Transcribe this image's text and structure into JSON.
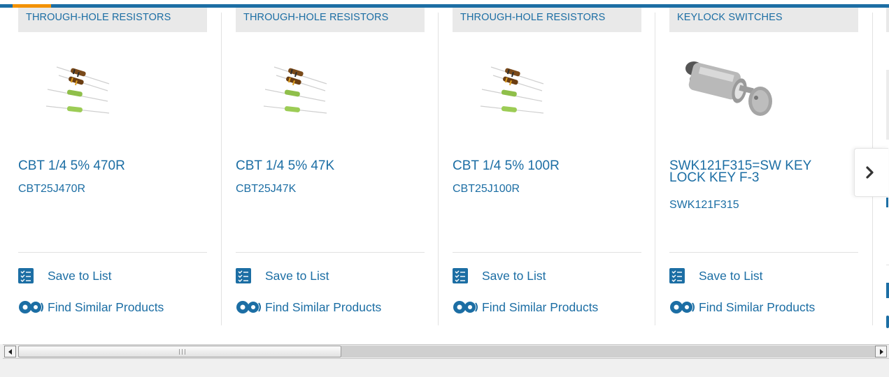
{
  "products": [
    {
      "category": "THROUGH-HOLE RESISTORS",
      "image_icon": "resistors-image",
      "name": "CBT 1/4 5% 470R",
      "part_number": "CBT25J470R",
      "save_label": "Save to List",
      "find_label": "Find Similar Products"
    },
    {
      "category": "THROUGH-HOLE RESISTORS",
      "image_icon": "resistors-image",
      "name": "CBT 1/4 5% 47K",
      "part_number": "CBT25J47K",
      "save_label": "Save to List",
      "find_label": "Find Similar Products"
    },
    {
      "category": "THROUGH-HOLE RESISTORS",
      "image_icon": "resistors-image",
      "name": "CBT 1/4 5% 100R",
      "part_number": "CBT25J100R",
      "save_label": "Save to List",
      "find_label": "Find Similar Products"
    },
    {
      "category": "KEYLOCK SWITCHES",
      "image_icon": "keylock-switch-image",
      "name": "SWK121F315=SW KEY LOCK KEY F-3",
      "part_number": "SWK121F315",
      "save_label": "Save to List",
      "find_label": "Find Similar Products"
    }
  ],
  "carousel": {
    "next_icon": "chevron-right-icon"
  },
  "scrollbar": {
    "left_icon": "arrow-left-icon",
    "right_icon": "arrow-right-icon",
    "position_fraction": 0.0
  },
  "colors": {
    "link_blue": "#1c6ea4",
    "accent_orange": "#f39200",
    "category_bg": "#e9e9e9"
  }
}
